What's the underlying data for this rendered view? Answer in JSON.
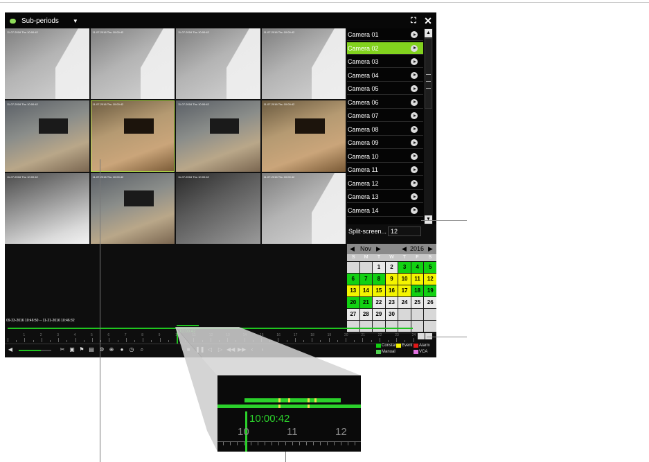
{
  "toolbar": {
    "mode_label": "Sub-periods"
  },
  "cameras": [
    "Camera 01",
    "Camera 02",
    "Camera 03",
    "Camera 04",
    "Camera 05",
    "Camera 06",
    "Camera 07",
    "Camera 08",
    "Camera 09",
    "Camera 10",
    "Camera 11",
    "Camera 12",
    "Camera 13",
    "Camera 14"
  ],
  "selected_camera": "Camera 02",
  "split_screen": {
    "label": "Split-screen...",
    "value": "12"
  },
  "calendar": {
    "month": "Nov",
    "year": "2016",
    "weekdays": [
      "S",
      "M",
      "T",
      "W",
      "T",
      "F",
      "S"
    ],
    "days": [
      {
        "d": "",
        "s": "e"
      },
      {
        "d": "",
        "s": "e"
      },
      {
        "d": "1",
        "s": "n"
      },
      {
        "d": "2",
        "s": "n"
      },
      {
        "d": "3",
        "s": "g"
      },
      {
        "d": "4",
        "s": "g"
      },
      {
        "d": "5",
        "s": "g"
      },
      {
        "d": "6",
        "s": "g"
      },
      {
        "d": "7",
        "s": "g"
      },
      {
        "d": "8",
        "s": "g"
      },
      {
        "d": "9",
        "s": "y"
      },
      {
        "d": "10",
        "s": "y"
      },
      {
        "d": "11",
        "s": "y"
      },
      {
        "d": "12",
        "s": "y"
      },
      {
        "d": "13",
        "s": "y"
      },
      {
        "d": "14",
        "s": "y"
      },
      {
        "d": "15",
        "s": "y"
      },
      {
        "d": "16",
        "s": "y"
      },
      {
        "d": "17",
        "s": "y"
      },
      {
        "d": "18",
        "s": "g"
      },
      {
        "d": "19",
        "s": "g"
      },
      {
        "d": "20",
        "s": "g"
      },
      {
        "d": "21",
        "s": "g"
      },
      {
        "d": "22",
        "s": "n"
      },
      {
        "d": "23",
        "s": "n"
      },
      {
        "d": "24",
        "s": "n"
      },
      {
        "d": "25",
        "s": "n"
      },
      {
        "d": "26",
        "s": "n"
      },
      {
        "d": "27",
        "s": "n"
      },
      {
        "d": "28",
        "s": "n"
      },
      {
        "d": "29",
        "s": "n"
      },
      {
        "d": "30",
        "s": "n"
      },
      {
        "d": "",
        "s": "e"
      },
      {
        "d": "",
        "s": "e"
      },
      {
        "d": "",
        "s": "e"
      },
      {
        "d": "",
        "s": "e"
      },
      {
        "d": "",
        "s": "e"
      },
      {
        "d": "",
        "s": "e"
      },
      {
        "d": "",
        "s": "e"
      },
      {
        "d": "",
        "s": "e"
      },
      {
        "d": "",
        "s": "e"
      },
      {
        "d": "",
        "s": "e"
      }
    ]
  },
  "timeline": {
    "range_text": "09-23-2016 10:46:50 -- 11-21-2016 10:46:32",
    "current_time": "10:00:42",
    "hours": [
      "1",
      "2",
      "3",
      "4",
      "5",
      "6",
      "7",
      "8",
      "9",
      "10",
      "11",
      "12",
      "13",
      "14",
      "15",
      "16",
      "17",
      "18",
      "19",
      "20",
      "21",
      "22",
      "23",
      "24"
    ]
  },
  "legend": [
    {
      "label": "Constant",
      "color": "#12d112"
    },
    {
      "label": "Event",
      "color": "#f4f400"
    },
    {
      "label": "Alarm",
      "color": "#e01818"
    },
    {
      "label": "Manual",
      "color": "#4fd14f"
    },
    {
      "label": "VCA",
      "color": "#e070e0"
    }
  ],
  "tiles": [
    "gray",
    "gray",
    "gray",
    "gray",
    "office",
    "warm",
    "office",
    "warm",
    "lightoff",
    "office",
    "dark",
    "gray"
  ],
  "tile_timestamp": "11-07-2016 Thu 10:00:42",
  "inset": {
    "time": "10:00:42",
    "labels": [
      "10",
      "11",
      "12"
    ]
  }
}
